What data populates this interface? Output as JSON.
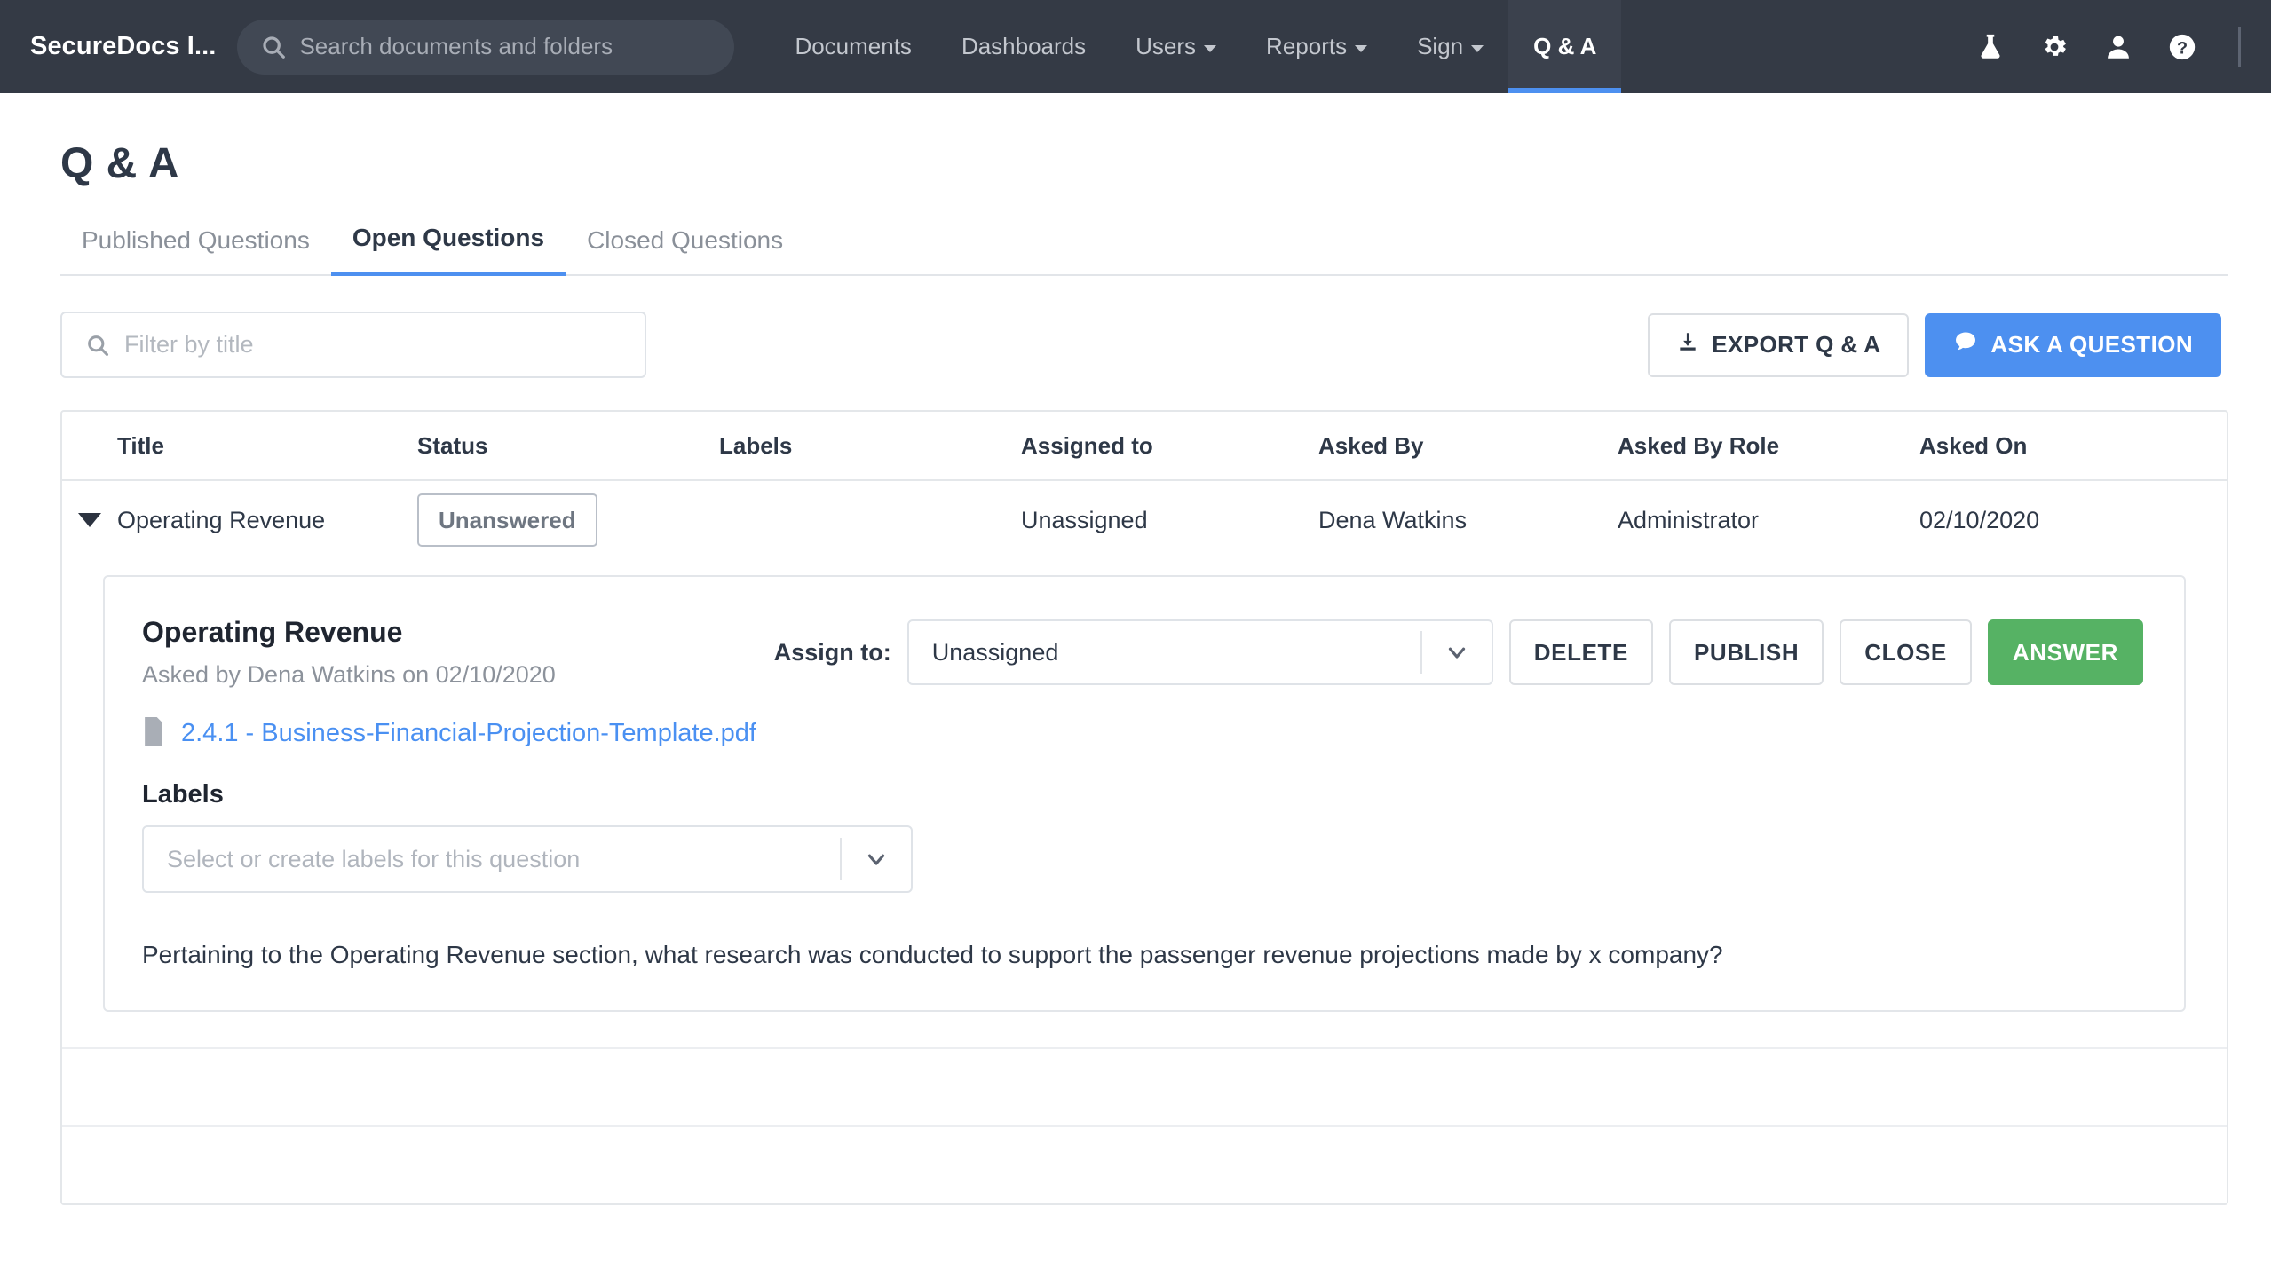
{
  "topnav": {
    "brand": "SecureDocs I...",
    "search": {
      "placeholder": "Search documents and folders",
      "value": ""
    },
    "items": [
      {
        "label": "Documents",
        "has_caret": false,
        "active": false
      },
      {
        "label": "Dashboards",
        "has_caret": false,
        "active": false
      },
      {
        "label": "Users",
        "has_caret": true,
        "active": false
      },
      {
        "label": "Reports",
        "has_caret": true,
        "active": false
      },
      {
        "label": "Sign",
        "has_caret": true,
        "active": false
      },
      {
        "label": "Q & A",
        "has_caret": false,
        "active": true
      }
    ],
    "icons": [
      "flask-icon",
      "gear-icon",
      "user-icon",
      "help-icon"
    ],
    "accent_color": "#4d90f0",
    "background_color": "#343a45"
  },
  "page": {
    "title": "Q & A",
    "tabs": [
      {
        "label": "Published Questions",
        "active": false
      },
      {
        "label": "Open Questions",
        "active": true
      },
      {
        "label": "Closed Questions",
        "active": false
      }
    ]
  },
  "toolbar": {
    "filter_placeholder": "Filter by title",
    "filter_value": "",
    "export_label": "EXPORT Q & A",
    "ask_label": "ASK A QUESTION"
  },
  "table": {
    "columns": [
      "Title",
      "Status",
      "Labels",
      "Assigned to",
      "Asked By",
      "Asked By Role",
      "Asked On"
    ],
    "rows": [
      {
        "title": "Operating Revenue",
        "status": "Unanswered",
        "labels": "",
        "assigned_to": "Unassigned",
        "asked_by": "Dena Watkins",
        "asked_by_role": "Administrator",
        "asked_on": "02/10/2020",
        "expanded": true
      }
    ],
    "empty_rows": 2
  },
  "detail": {
    "title": "Operating Revenue",
    "subtitle": "Asked by Dena Watkins on 02/10/2020",
    "assign_label": "Assign to:",
    "assign_value": "Unassigned",
    "buttons": {
      "delete": "DELETE",
      "publish": "PUBLISH",
      "close": "CLOSE",
      "answer": "ANSWER"
    },
    "answer_button_color": "#56b264",
    "document_link": "2.4.1 - Business-Financial-Projection-Template.pdf",
    "document_link_color": "#4a90f2",
    "labels_heading": "Labels",
    "labels_placeholder": "Select or create labels for this question",
    "question_text": "Pertaining to the Operating Revenue section, what research was conducted to support the passenger revenue projections made by x company?"
  }
}
